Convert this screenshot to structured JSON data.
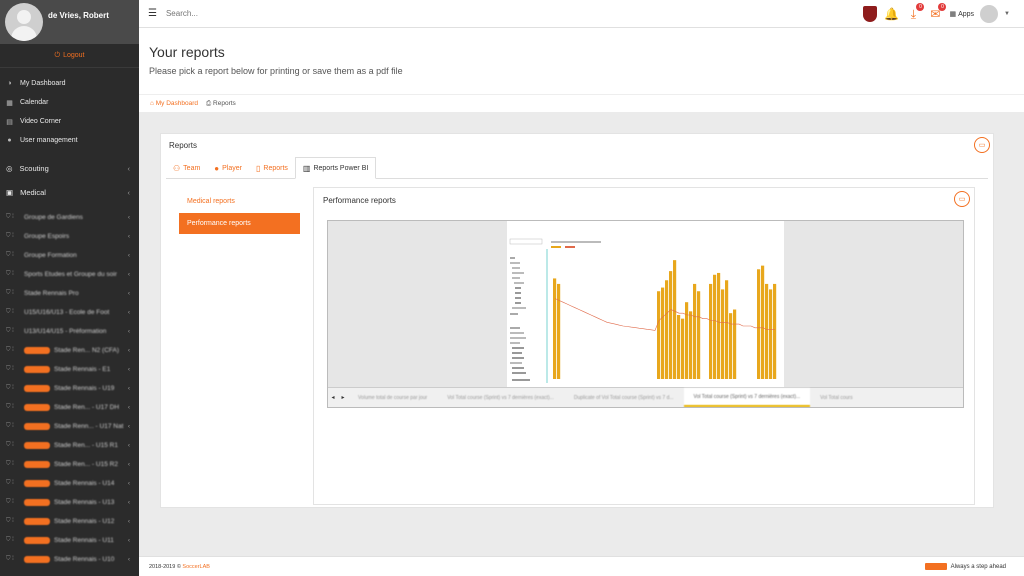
{
  "user": {
    "name": "de Vries, Robert"
  },
  "sidebar": {
    "logout": "Logout",
    "items": [
      {
        "label": "My Dashboard",
        "icon": "dashboard-icon"
      },
      {
        "label": "Calendar",
        "icon": "calendar-icon"
      },
      {
        "label": "Video Corner",
        "icon": "film-icon"
      },
      {
        "label": "User management",
        "icon": "user-icon"
      }
    ],
    "sections": [
      {
        "label": "Scouting",
        "icon": "binoculars-icon"
      },
      {
        "label": "Medical",
        "icon": "medkit-icon"
      }
    ],
    "teams": [
      {
        "label": "Groupe de Gardiens",
        "pill": false
      },
      {
        "label": "Groupe Espoirs",
        "pill": false
      },
      {
        "label": "Groupe Formation",
        "pill": false
      },
      {
        "label": "Sports Etudes et Groupe du soir",
        "pill": false
      },
      {
        "label": "Stade Rennais Pro",
        "pill": false
      },
      {
        "label": "U15/U16/U13 - Ecole de Foot",
        "pill": false
      },
      {
        "label": "U13/U14/U15 - Préformation",
        "pill": false
      },
      {
        "label": "Stade Ren... N2 (CFA)",
        "pill": true
      },
      {
        "label": "Stade Rennais - E1",
        "pill": true
      },
      {
        "label": "Stade Rennais - U19",
        "pill": true
      },
      {
        "label": "Stade Ren... - U17 DH",
        "pill": true
      },
      {
        "label": "Stade Renn... - U17 Nat",
        "pill": true
      },
      {
        "label": "Stade Ren... - U15 R1",
        "pill": true
      },
      {
        "label": "Stade Ren... - U15 R2",
        "pill": true
      },
      {
        "label": "Stade Rennais - U14",
        "pill": true
      },
      {
        "label": "Stade Rennais - U13",
        "pill": true
      },
      {
        "label": "Stade Rennais - U12",
        "pill": true
      },
      {
        "label": "Stade Rennais - U11",
        "pill": true
      },
      {
        "label": "Stade Rennais - U10",
        "pill": true
      }
    ]
  },
  "topbar": {
    "search_placeholder": "Search...",
    "apps_label": "Apps",
    "badge_downloads": "0",
    "badge_messages": "0"
  },
  "header": {
    "title": "Your reports",
    "subtitle": "Please pick a report below for printing or save them as a pdf file"
  },
  "breadcrumb": {
    "home": "My Dashboard",
    "current": "Reports"
  },
  "panel": {
    "title": "Reports",
    "tabs": [
      {
        "label": "Team",
        "icon": "users-icon"
      },
      {
        "label": "Player",
        "icon": "user-icon"
      },
      {
        "label": "Reports",
        "icon": "file-icon"
      },
      {
        "label": "Reports Power BI",
        "icon": "bar-chart-icon"
      }
    ],
    "active_tab": 3,
    "menu": [
      "Medical reports",
      "Performance reports"
    ],
    "active_menu": 1
  },
  "report": {
    "title": "Performance reports",
    "tabs": [
      "Volume total de course par jour",
      "Vol Total course (Sprint) vs 7 dernières (exact)...",
      "Duplicate of Vol Total course (Sprint) vs 7 d...",
      "Vol Total course (Sprint) vs 7 dernières (exact)...",
      "Vol Total cours"
    ],
    "active_tab": 3
  },
  "chart_data": {
    "type": "bar",
    "values": [
      55,
      52,
      0,
      0,
      0,
      0,
      0,
      0,
      0,
      0,
      0,
      0,
      0,
      0,
      0,
      0,
      0,
      0,
      0,
      0,
      0,
      0,
      0,
      0,
      0,
      0,
      48,
      50,
      54,
      59,
      65,
      35,
      33,
      42,
      37,
      52,
      48,
      0,
      0,
      52,
      57,
      58,
      49,
      54,
      36,
      38,
      0,
      0,
      0,
      0,
      0,
      60,
      62,
      52,
      49,
      52
    ],
    "line": [
      44,
      43,
      42,
      41,
      40,
      39,
      38,
      37,
      36,
      35,
      34,
      33,
      32,
      31,
      30.5,
      30,
      29.5,
      29,
      28.7,
      28.4,
      28.1,
      27.8,
      27.5,
      27.2,
      26.9,
      26.6,
      32,
      34,
      36,
      38,
      37,
      36,
      36,
      35,
      35,
      34,
      34,
      33,
      33,
      32,
      32,
      31,
      31,
      31,
      30,
      30,
      30,
      29,
      29,
      29,
      28,
      28,
      28,
      27,
      27,
      27
    ],
    "colors": {
      "bar": "#e8a71c",
      "line": "#e06a4a"
    }
  }
}
